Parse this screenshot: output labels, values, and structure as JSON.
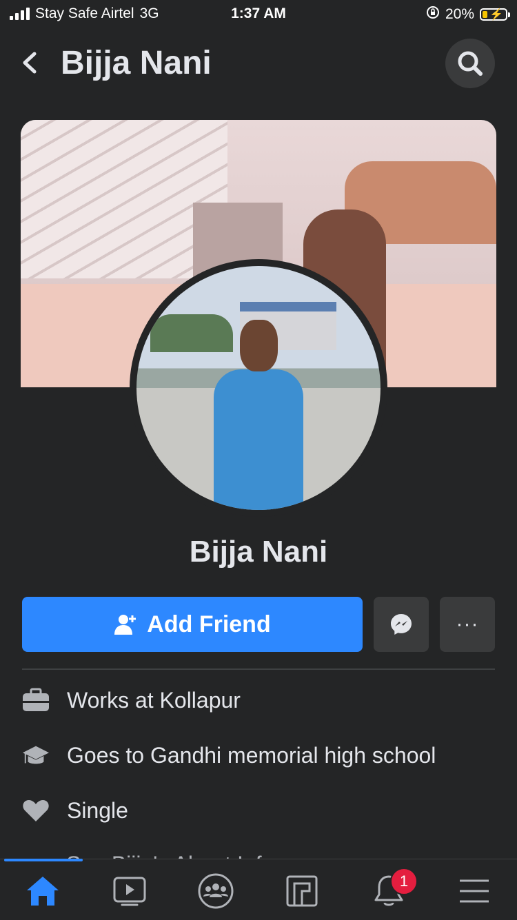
{
  "status_bar": {
    "carrier": "Stay Safe Airtel",
    "network": "3G",
    "time": "1:37 AM",
    "battery": "20%"
  },
  "header": {
    "title": "Bijja Nani"
  },
  "profile": {
    "name": "Bijja Nani",
    "add_friend_label": "Add Friend",
    "more_label": "···"
  },
  "details": [
    {
      "icon": "briefcase-icon",
      "prefix": "Works at ",
      "value": "Kollapur"
    },
    {
      "icon": "graduation-cap-icon",
      "prefix": "Goes to ",
      "value": "Gandhi memorial high school"
    },
    {
      "icon": "heart-icon",
      "prefix": "",
      "value": "Single"
    }
  ],
  "peek_text": "See Bijja's About Info",
  "tab_bar": {
    "notifications_badge": "1"
  },
  "colors": {
    "background": "#242526",
    "accent": "#2d88ff",
    "badge": "#e41e3f"
  }
}
